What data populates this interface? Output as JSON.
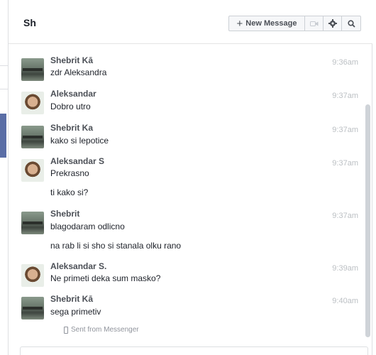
{
  "header": {
    "title": "Sh",
    "new_message_label": "New Message"
  },
  "messages": [
    {
      "sender": "Shebrit Kā",
      "time": "9:36am",
      "lines": [
        "zdr Aleksandra"
      ],
      "avatar": "shebrit"
    },
    {
      "sender": "Aleksandar",
      "time": "9:37am",
      "lines": [
        "Dobro utro"
      ],
      "avatar": "aleks"
    },
    {
      "sender": "Shebrit Ka",
      "time": "9:37am",
      "lines": [
        "kako si lepotice"
      ],
      "avatar": "shebrit"
    },
    {
      "sender": "Aleksandar S",
      "time": "9:37am",
      "lines": [
        "Prekrasno",
        "ti kako si?"
      ],
      "avatar": "aleks"
    },
    {
      "sender": "Shebrit",
      "time": "9:37am",
      "lines": [
        "blagodaram odlicno",
        "na rab li si sho si stanala olku rano"
      ],
      "avatar": "shebrit"
    },
    {
      "sender": "Aleksandar S.",
      "time": "9:39am",
      "lines": [
        "Ne primeti deka sum masko?"
      ],
      "avatar": "aleks"
    },
    {
      "sender": "Shebrit Kā",
      "time": "9:40am",
      "lines": [
        "sega primetiv"
      ],
      "avatar": "shebrit"
    }
  ],
  "sent_from": "Sent from Messenger"
}
